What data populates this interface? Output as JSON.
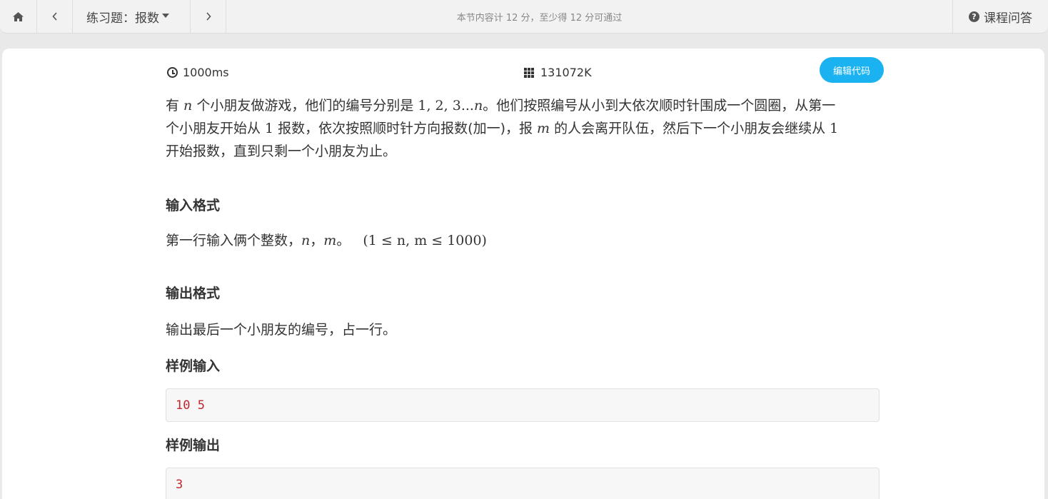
{
  "topbar": {
    "title": "练习题：报数",
    "status": "本节内容计 12 分，至少得 12 分可通过",
    "qa_label": "课程问答",
    "qmark": "?"
  },
  "meta": {
    "time_limit": "1000ms",
    "memory_limit": "131072K",
    "edit_button": "编辑代码"
  },
  "problem": {
    "desc_line1_a": "有 ",
    "desc_n1": "n",
    "desc_line1_b": " 个小朋友做游戏，他们的编号分别是 ",
    "desc_seq": "1, 2, 3...",
    "desc_n2": "n",
    "desc_line1_c": "。他们按照编号从小到大依次顺时针围成一个圆圈，从第一",
    "desc_line2_a": "个小朋友开始从 ",
    "desc_one1": "1",
    "desc_line2_b": " 报数，依次按照顺时针方向报数(加一)，报 ",
    "desc_m": "m",
    "desc_line2_c": " 的人会离开队伍，然后下一个小朋友会继续从 ",
    "desc_one2": "1",
    "desc_line3": "开始报数，直到只剩一个小朋友为止。",
    "input_heading": "输入格式",
    "input_text_a": "第一行输入俩个整数，",
    "input_n": "n",
    "input_sep": "，",
    "input_m": "m",
    "input_text_b": "。",
    "input_range": "(1 ≤ n, m ≤ 1000)",
    "output_heading": "输出格式",
    "output_text": "输出最后一个小朋友的编号，占一行。",
    "sample_input_heading": "样例输入",
    "sample_input": "10 5",
    "sample_output_heading": "样例输出",
    "sample_output": "3"
  }
}
